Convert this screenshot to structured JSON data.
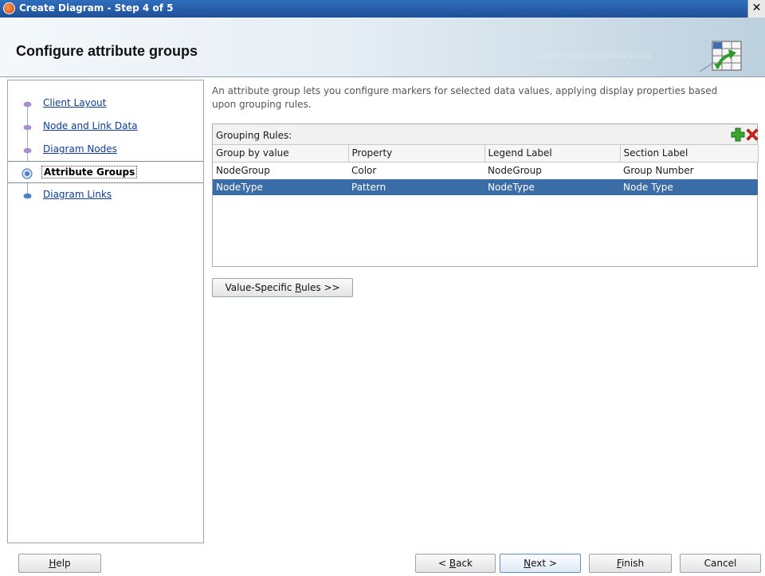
{
  "window": {
    "title": "Create Diagram - Step 4 of 5",
    "close_glyph": "✕"
  },
  "header": {
    "heading": "Configure attribute groups",
    "decoration_text": "0101010101010101001010101"
  },
  "steps": [
    {
      "label": "Client Layout",
      "state": "visited"
    },
    {
      "label": "Node and Link Data",
      "state": "visited"
    },
    {
      "label": "Diagram Nodes",
      "state": "visited"
    },
    {
      "label": "Attribute Groups",
      "state": "current"
    },
    {
      "label": "Diagram Links",
      "state": "upcoming"
    }
  ],
  "main": {
    "description": "An attribute group lets you configure markers for selected data values, applying display properties based upon grouping rules.",
    "grouping_rules": {
      "caption": "Grouping Rules:",
      "columns": [
        "Group by value",
        "Property",
        "Legend Label",
        "Section Label"
      ],
      "rows": [
        [
          "NodeGroup",
          "Color",
          "NodeGroup",
          "Group Number"
        ],
        [
          "NodeType",
          "Pattern",
          "NodeType",
          "Node Type"
        ]
      ],
      "selected_row": 1
    },
    "value_specific_button": {
      "prefix": "Value-Specific ",
      "mnemonic": "R",
      "suffix": "ules >>"
    }
  },
  "footer": {
    "help": {
      "mnemonic": "H",
      "rest": "elp"
    },
    "back": {
      "prefix": "< ",
      "mnemonic": "B",
      "rest": "ack"
    },
    "next": {
      "mnemonic": "N",
      "rest": "ext >"
    },
    "finish": {
      "mnemonic": "F",
      "rest": "inish"
    },
    "cancel": {
      "label": "Cancel"
    }
  },
  "icons": {
    "add": "add-icon",
    "delete": "delete-icon",
    "app": "app-icon",
    "wizard_art": "diagram-wizard-icon"
  },
  "colors": {
    "selection": "#3a6ca8",
    "visited_link": "#4c2a8a",
    "link": "#0b3d9e",
    "add_green": "#3aa630",
    "delete_red": "#d0281a"
  }
}
